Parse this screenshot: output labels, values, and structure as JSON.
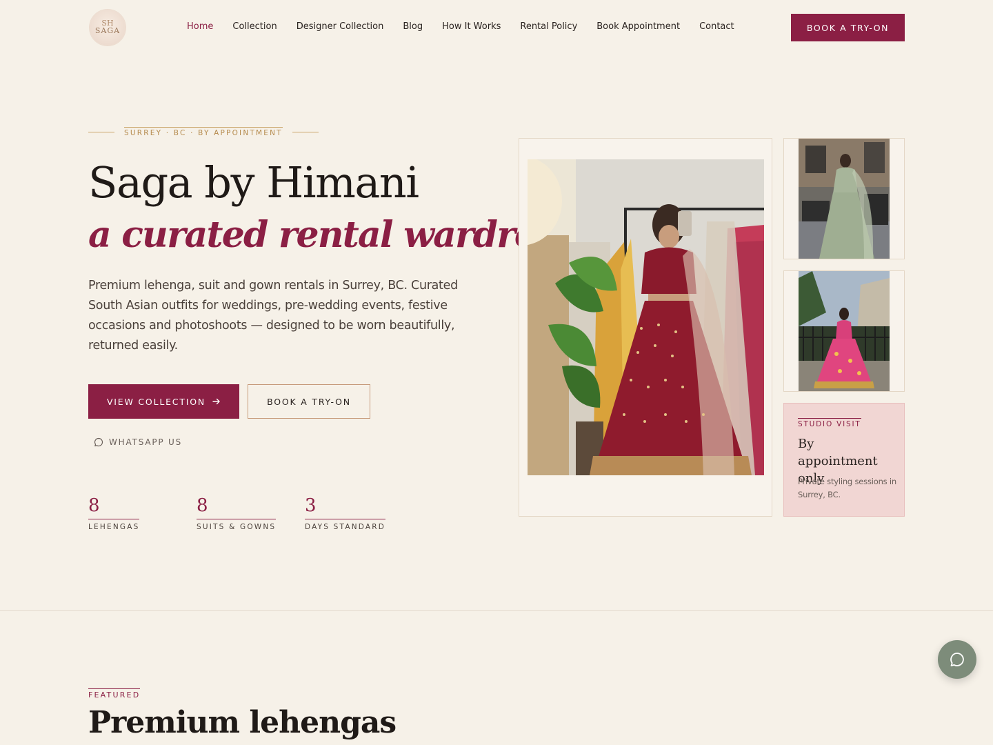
{
  "brand": {
    "logo_mono": "SH",
    "logo_text": "SAGA"
  },
  "nav": {
    "links": [
      {
        "label": "Home",
        "active": true
      },
      {
        "label": "Collection"
      },
      {
        "label": "Designer Collection"
      },
      {
        "label": "Blog"
      },
      {
        "label": "How It Works"
      },
      {
        "label": "Rental Policy"
      },
      {
        "label": "Book Appointment"
      },
      {
        "label": "Contact"
      }
    ],
    "cta": "BOOK A TRY-ON"
  },
  "hero": {
    "eyebrow": "SURREY · BC · BY APPOINTMENT",
    "title": "Saga by Himani",
    "subtitle": "a curated rental wardrobe",
    "description": "Premium lehenga, suit and gown rentals in Surrey, BC. Curated South Asian outfits for weddings, pre-wedding events, festive occasions and photoshoots — designed to be worn beautifully, returned easily.",
    "primary_button": "VIEW COLLECTION",
    "secondary_button": "BOOK A TRY-ON",
    "whatsapp": "WHATSAPP US",
    "stats": [
      {
        "value": "8",
        "label": "LEHENGAS"
      },
      {
        "value": "8",
        "label": "SUITS & GOWNS"
      },
      {
        "value": "3",
        "label": "DAYS STANDARD"
      }
    ]
  },
  "studio": {
    "eyebrow": "STUDIO VISIT",
    "title": "By appointment only",
    "text": "Private styling sessions in Surrey, BC."
  },
  "featured": {
    "eyebrow": "FEATURED",
    "title": "Premium lehengas"
  },
  "colors": {
    "background": "#f6f1e8",
    "accent": "#8b1f44",
    "gold": "#b58a4c",
    "studio_card": "#f1d6d3",
    "chat_fab": "#7d8c7a"
  },
  "icons": {
    "arrow": "arrow-right-icon",
    "whatsapp": "chat-bubble-icon",
    "chat_fab": "chat-bubble-icon"
  }
}
